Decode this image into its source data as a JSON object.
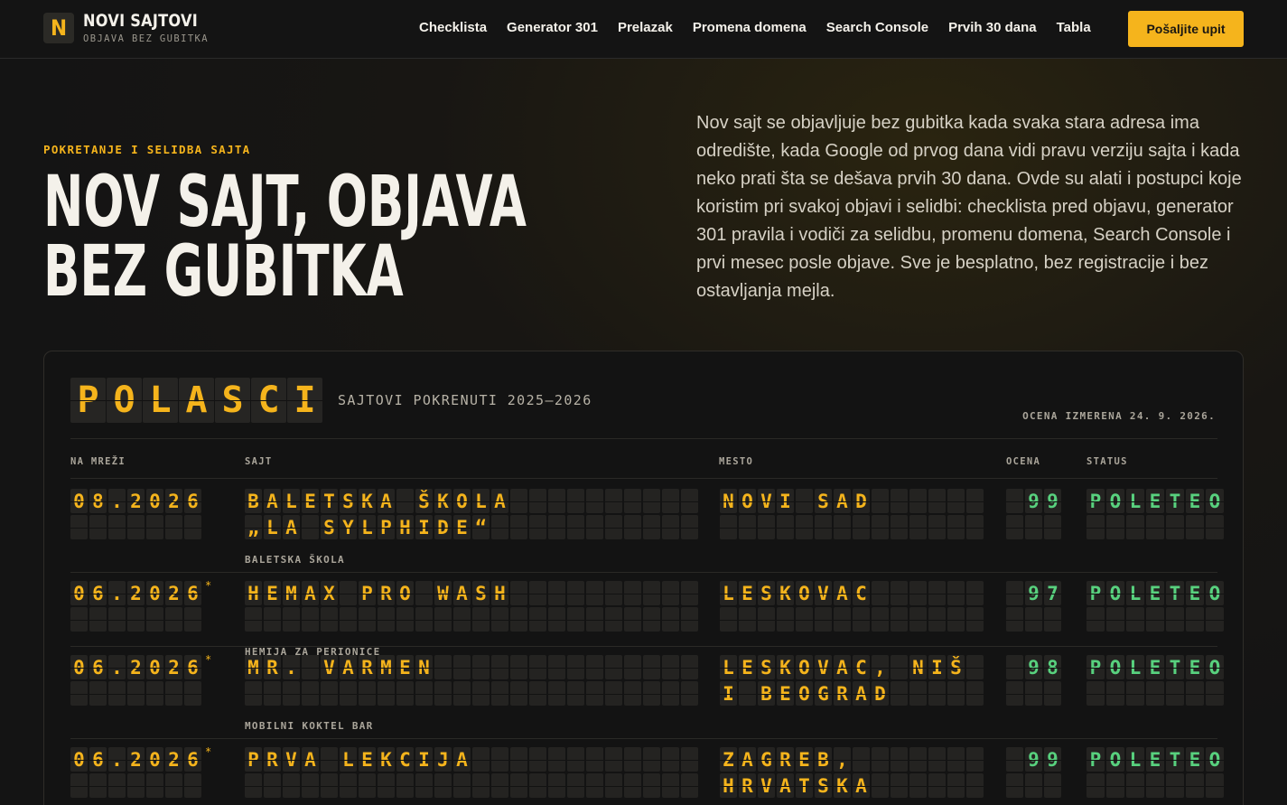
{
  "brand": {
    "mark": "N",
    "name": "NOVI SAJTOVI",
    "tagline": "OBJAVA BEZ GUBITKA"
  },
  "nav": [
    "Checklista",
    "Generator 301",
    "Prelazak",
    "Promena domena",
    "Search Console",
    "Prvih 30 dana",
    "Tabla"
  ],
  "cta": "Pošaljite upit",
  "hero": {
    "eyebrow": "POKRETANJE I SELIDBA SAJTA",
    "title_line1": "NOV SAJT, OBJAVA",
    "title_line2": "BEZ GUBITKA",
    "lead": "Nov sajt se objavljuje bez gubitka kada svaka stara adresa ima odredište, kada Google od prvog dana vidi pravu verziju sajta i kada neko prati šta se dešava prvih 30 dana. Ovde su alati i postupci koje koristim pri svakoj objavi i selidbi: checklista pred objavu, generator 301 pravila i vodiči za selidbu, promenu domena, Search Console i prvi mesec posle objave. Sve je besplatno, bez registracije i bez ostavljanja mejla."
  },
  "board": {
    "title": "POLASCI",
    "subtitle": "SAJTOVI POKRENUTI 2025–2026",
    "measured": "OCENA IZMERENA 24. 9. 2026.",
    "columns": {
      "date": "NA MREŽI",
      "site": "SAJT",
      "place": "MESTO",
      "score": "OCENA",
      "status": "STATUS"
    },
    "rows": [
      {
        "date": "08.2026",
        "star": "",
        "site": [
          "BALETSKA ŠKOLA",
          "„LA SYLPHIDE“"
        ],
        "category": "BALETSKA ŠKOLA",
        "place": [
          "NOVI SAD",
          ""
        ],
        "score": "99",
        "status": "POLETEO"
      },
      {
        "date": "06.2026",
        "star": "*",
        "site": [
          "HEMAX PRO WASH"
        ],
        "category": "HEMIJA ZA PERIONICE",
        "place": [
          "LESKOVAC"
        ],
        "score": "97",
        "status": "POLETEO"
      },
      {
        "date": "06.2026",
        "star": "*",
        "site": [
          "MR. VARMEN",
          ""
        ],
        "category": "MOBILNI KOKTEL BAR",
        "place": [
          "LESKOVAC, NIŠ",
          "I BEOGRAD"
        ],
        "score": "98",
        "status": "POLETEO"
      },
      {
        "date": "06.2026",
        "star": "*",
        "site": [
          "PRVA LEKCIJA",
          ""
        ],
        "category": "",
        "place": [
          "ZAGREB,",
          "HRVATSKA"
        ],
        "score": "99",
        "status": "POLETEO"
      }
    ]
  },
  "colors": {
    "accent": "#f5b41c",
    "ok": "#58d17e",
    "background": "#141414"
  }
}
